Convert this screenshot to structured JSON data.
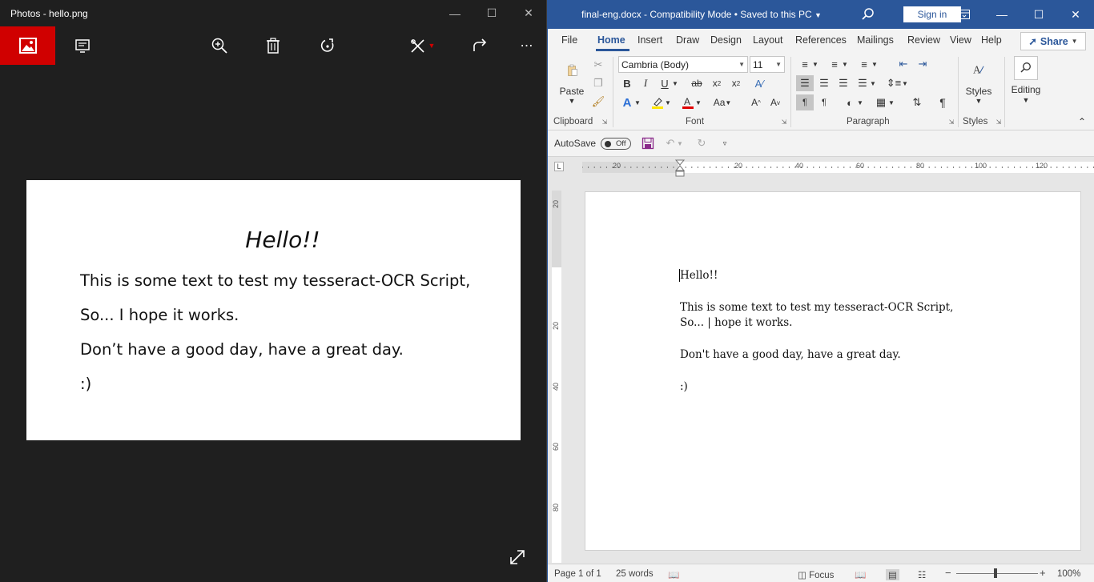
{
  "photos": {
    "title": "Photos - hello.png",
    "image_text": {
      "heading": "Hello!!",
      "line1": "This is some text to test my tesseract-OCR Script,",
      "line2": "So... I hope it works.",
      "line3": "Don’t have a good day, have a great day.",
      "line4": ":)"
    },
    "accent_color": "#d00000"
  },
  "word": {
    "title": "final-eng.docx  -  Compatibility Mode  •  Saved to this PC",
    "sign_in": "Sign in",
    "tabs": [
      "File",
      "Home",
      "Insert",
      "Draw",
      "Design",
      "Layout",
      "References",
      "Mailings",
      "Review",
      "View",
      "Help"
    ],
    "share": "Share",
    "ribbon": {
      "paste": "Paste",
      "font_name": "Cambria (Body)",
      "font_size": "11",
      "styles": "Styles",
      "editing": "Editing",
      "groups": [
        "Clipboard",
        "Font",
        "Paragraph",
        "Styles"
      ]
    },
    "qat": {
      "autosave": "AutoSave",
      "toggle": "Off"
    },
    "ruler_numbers": [
      "20",
      "20",
      "40",
      "60",
      "80",
      "100",
      "120"
    ],
    "vruler_numbers": [
      "20",
      "20",
      "40",
      "60",
      "80"
    ],
    "document": {
      "line1": "Hello!!",
      "line2": "This is some text to test my tesseract-OCR Script,",
      "line3": "So... | hope it works.",
      "line4": "Don't have a good day, have a great day.",
      "line5": ":)"
    },
    "status": {
      "page": "Page 1 of 1",
      "words": "25 words",
      "focus": "Focus",
      "zoom": "100%"
    },
    "brand_color": "#2b579a"
  }
}
